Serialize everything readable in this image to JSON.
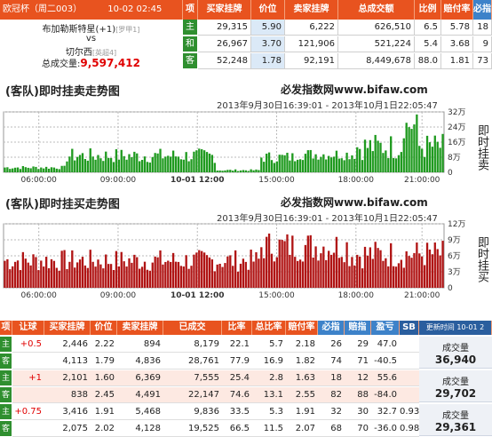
{
  "top_table": {
    "match_header": "欧冠杯（周二003）",
    "time": "10-02 02:45",
    "headers": [
      "项",
      "买家挂牌",
      "价位",
      "卖家挂牌",
      "总成交额",
      "比例",
      "赔付率",
      "必指"
    ],
    "home_team": "布加勒斯特星(+1)",
    "home_rank": "[罗甲1]",
    "vs": "vs",
    "away_team": "切尔西",
    "away_rank": "[英超4]",
    "total_label": "总成交量:",
    "total_value": "9,597,412",
    "rows": [
      {
        "tag": "主",
        "buy": "29,315",
        "price": "5.90",
        "sell": "6,222",
        "total": "626,510",
        "ratio": "6.5",
        "pay": "5.78",
        "idx": "18"
      },
      {
        "tag": "和",
        "buy": "26,967",
        "price": "3.70",
        "sell": "121,906",
        "total": "521,224",
        "ratio": "5.4",
        "pay": "3.68",
        "idx": "9"
      },
      {
        "tag": "客",
        "buy": "52,248",
        "price": "1.78",
        "sell": "92,191",
        "total": "8,449,678",
        "ratio": "88.0",
        "pay": "1.81",
        "idx": "73"
      }
    ]
  },
  "chart1": {
    "title": "(客队)即时挂卖走势图",
    "brand": "必发指数网www.bifaw.com",
    "range": "2013年9月30日16:39:01 - 2013年10月1日22:05:47",
    "yticks": [
      "32万",
      "24万",
      "16万",
      "8万",
      "0"
    ],
    "xticks": [
      "06:00:00",
      "09:00:00",
      "10-01 12:00",
      "15:00:00",
      "18:00:00",
      "21:00:00"
    ],
    "side_label": "即时挂卖",
    "color": "#1f9a1f"
  },
  "chart2": {
    "title": "(客队)即时挂买走势图",
    "brand": "必发指数网www.bifaw.com",
    "range": "2013年9月30日16:39:01 - 2013年10月1日22:05:47",
    "yticks": [
      "12万",
      "9万",
      "6万",
      "3万",
      "0"
    ],
    "xticks": [
      "06:00:00",
      "09:00:00",
      "10-01 12:00",
      "15:00:00",
      "18:00:00",
      "21:00:00"
    ],
    "side_label": "即时挂买",
    "color": "#b01414"
  },
  "bottom_table": {
    "headers": [
      "项",
      "让球",
      "买家挂牌",
      "价位",
      "卖家挂牌",
      "已成交",
      "比率",
      "总比率",
      "赔付率",
      "必指",
      "赔指",
      "盈亏",
      "SB",
      "更新时间 10-01 2"
    ],
    "rows": [
      {
        "tag": "主",
        "hcp": "+0.5",
        "buy": "2,446",
        "price": "2.22",
        "sell": "894",
        "done": "8,179",
        "r": "22.1",
        "tr": "5.7",
        "pay": "2.18",
        "bz": "26",
        "pz": "29",
        "pl": "47.0",
        "sb": ""
      },
      {
        "tag": "客",
        "hcp": "",
        "buy": "4,113",
        "price": "1.79",
        "sell": "4,836",
        "done": "28,761",
        "r": "77.9",
        "tr": "16.9",
        "pay": "1.82",
        "bz": "74",
        "pz": "71",
        "pl": "-40.5",
        "sb": ""
      },
      {
        "tag": "主",
        "hcp": "+1",
        "buy": "2,101",
        "price": "1.60",
        "sell": "6,369",
        "done": "7,555",
        "r": "25.4",
        "tr": "2.8",
        "pay": "1.63",
        "bz": "18",
        "pz": "12",
        "pl": "55.6",
        "sb": ""
      },
      {
        "tag": "客",
        "hcp": "",
        "buy": "838",
        "price": "2.45",
        "sell": "4,491",
        "done": "22,147",
        "r": "74.6",
        "tr": "13.1",
        "pay": "2.55",
        "bz": "82",
        "pz": "88",
        "pl": "-84.0",
        "sb": ""
      },
      {
        "tag": "主",
        "hcp": "+0.75",
        "buy": "3,416",
        "price": "1.91",
        "sell": "5,468",
        "done": "9,836",
        "r": "33.5",
        "tr": "5.3",
        "pay": "1.91",
        "bz": "32",
        "pz": "30",
        "pl": "32.7",
        "sb": "0.93"
      },
      {
        "tag": "客",
        "hcp": "",
        "buy": "2,075",
        "price": "2.02",
        "sell": "4,128",
        "done": "19,525",
        "r": "66.5",
        "tr": "11.5",
        "pay": "2.07",
        "bz": "68",
        "pz": "70",
        "pl": "-36.0",
        "sb": "0.98"
      }
    ],
    "side": [
      {
        "label": "成交量",
        "value": "36,940"
      },
      {
        "label": "成交量",
        "value": "29,702"
      },
      {
        "label": "成交量",
        "value": "29,361"
      }
    ]
  }
}
